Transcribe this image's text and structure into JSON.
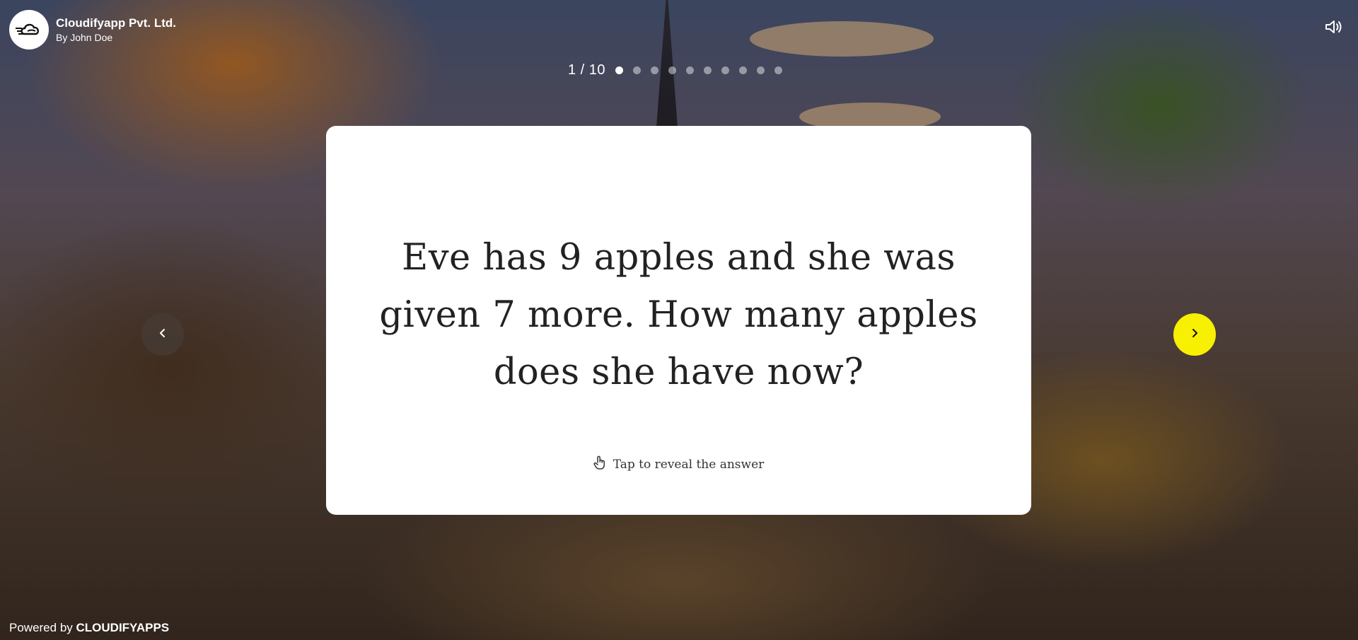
{
  "header": {
    "brand_name": "Cloudifyapp Pvt. Ltd.",
    "author": "By John Doe",
    "logo_icon": "cloud-speed-logo-icon",
    "sound_icon": "speaker-icon"
  },
  "progress": {
    "counter": "1 / 10",
    "current": 1,
    "total": 10
  },
  "card": {
    "question": "Eve has 9 apples and she was given 7 more. How many apples does she have now?",
    "reveal_label": "Tap to reveal the answer",
    "reveal_icon": "tap-hand-icon"
  },
  "nav": {
    "prev_icon": "chevron-left-icon",
    "next_icon": "chevron-right-icon",
    "next_color": "#f7f000"
  },
  "footer": {
    "prefix": "Powered by ",
    "brand": "CLOUDIFYAPPS"
  }
}
